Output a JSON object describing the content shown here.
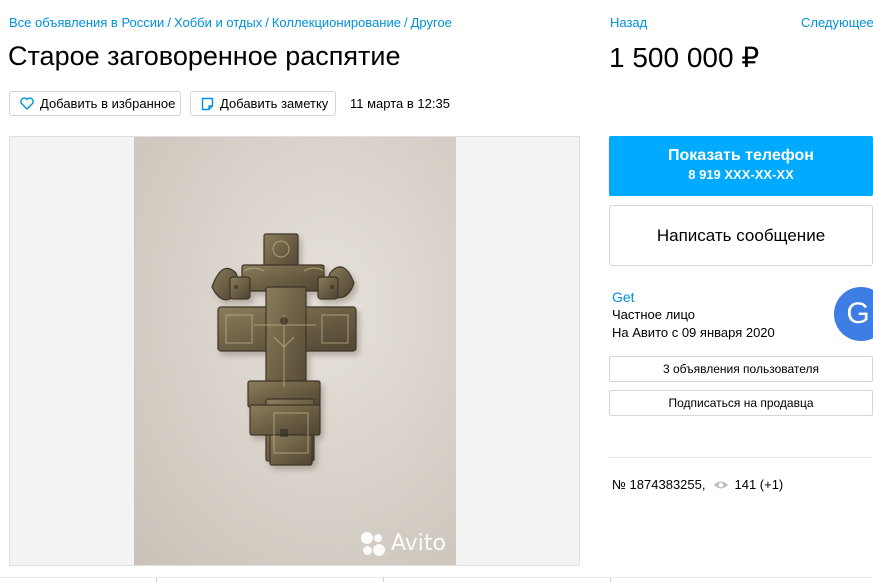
{
  "breadcrumbs": [
    "Все объявления в России",
    "Хобби и отдых",
    "Коллекционирование",
    "Другое"
  ],
  "breadcrumb_separator": "/",
  "nav": {
    "prev": "Назад",
    "next": "Следующее"
  },
  "listing": {
    "title": "Старое заговоренное распятие",
    "price": "1 500 000 ₽",
    "date": "11 марта в 12:35",
    "number": "№ 1874383255,",
    "views": "141 (+1)"
  },
  "actions": {
    "favorite": "Добавить в избранное",
    "note": "Добавить заметку"
  },
  "contact": {
    "show_phone": "Показать телефон",
    "phone_masked": "8 919 XXX-XX-XX",
    "write_message": "Написать сообщение"
  },
  "seller": {
    "name": "Get",
    "type": "Частное лицо",
    "since": "На Авито с 09 января 2020",
    "avatar_letter": "G",
    "listings_link": "3 объявления пользователя",
    "subscribe": "Подписаться на продавца"
  },
  "photo": {
    "watermark": "Avito",
    "subject": "cross-photo"
  },
  "icons": [
    "heart-icon",
    "note-icon",
    "eye-icon",
    "avito-logo-icon"
  ],
  "colors": {
    "accent": "#00aaff",
    "link": "#0091d9",
    "avatar": "#3d7de4"
  }
}
